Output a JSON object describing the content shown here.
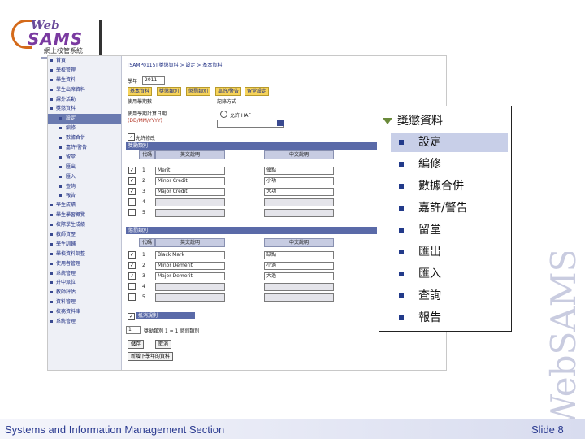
{
  "logo": {
    "web": "Web",
    "sams": "SAMS",
    "chinese": "網上校管系統"
  },
  "nav": {
    "items": [
      {
        "label": "首頁",
        "sub": false
      },
      {
        "label": "學校管理",
        "sub": false
      },
      {
        "label": "學生資料",
        "sub": false
      },
      {
        "label": "學生出席資料",
        "sub": false
      },
      {
        "label": "課外活動",
        "sub": false
      },
      {
        "label": "獎懲資料",
        "sub": false
      },
      {
        "label": "設定",
        "sub": true,
        "selected": true
      },
      {
        "label": "編修",
        "sub": true
      },
      {
        "label": "數據合併",
        "sub": true
      },
      {
        "label": "嘉許/警告",
        "sub": true
      },
      {
        "label": "留堂",
        "sub": true
      },
      {
        "label": "匯出",
        "sub": true
      },
      {
        "label": "匯入",
        "sub": true
      },
      {
        "label": "查詢",
        "sub": true
      },
      {
        "label": "報告",
        "sub": true
      },
      {
        "label": "學生成績",
        "sub": false
      },
      {
        "label": "學生學習概覽",
        "sub": false
      },
      {
        "label": "校際學生成績",
        "sub": false
      },
      {
        "label": "教師資歷",
        "sub": false
      },
      {
        "label": "學生訓輔",
        "sub": false
      },
      {
        "label": "學校資料調整",
        "sub": false
      },
      {
        "label": "使用者管理",
        "sub": false
      },
      {
        "label": "系統管理",
        "sub": false
      },
      {
        "label": "升中派位",
        "sub": false
      },
      {
        "label": "教師評估",
        "sub": false
      },
      {
        "label": "資料管理",
        "sub": false
      },
      {
        "label": "校務資料庫",
        "sub": false
      },
      {
        "label": "系統管理",
        "sub": false
      }
    ]
  },
  "main": {
    "breadcrumb": "[SAMP0115] 獎懲資料 > 設定 > 基本資料",
    "year_label": "學年",
    "year_value": "2011",
    "tabs": [
      "基本資料",
      "獎懲類別",
      "懲罰類別",
      "嘉許/警告",
      "留堂設定"
    ],
    "settings_left": "使用學期數",
    "settings_right": "記錄方式",
    "date_label": "使用學期計算日期",
    "date_format": "(DD/MM/YYYY)",
    "radio_label": "允許 HAF",
    "allow_edit": "允許修改",
    "merit_header": "獎勵類別",
    "demerit_header": "懲罰類別",
    "col_code": "代碼",
    "col_en": "英文說明",
    "col_zh": "中文說明",
    "merit_rows": [
      {
        "n": "1",
        "en": "Merit",
        "zh": "優點",
        "checked": true
      },
      {
        "n": "2",
        "en": "Minor Credit",
        "zh": "小功",
        "checked": true
      },
      {
        "n": "3",
        "en": "Major Credit",
        "zh": "大功",
        "checked": true
      },
      {
        "n": "4",
        "en": "",
        "zh": "",
        "checked": false
      },
      {
        "n": "5",
        "en": "",
        "zh": "",
        "checked": false
      }
    ],
    "demerit_rows": [
      {
        "n": "1",
        "en": "Black Mark",
        "zh": "缺點",
        "checked": true
      },
      {
        "n": "2",
        "en": "Minor Demerit",
        "zh": "小過",
        "checked": true
      },
      {
        "n": "3",
        "en": "Major Demerit",
        "zh": "大過",
        "checked": true
      },
      {
        "n": "4",
        "en": "",
        "zh": "",
        "checked": false
      },
      {
        "n": "5",
        "en": "",
        "zh": "",
        "checked": false
      }
    ],
    "convert_label": "抵消規則",
    "convert_from": "1",
    "convert_text": "獎勵類別 1 = 1 懲罰類別",
    "save_label": "儲存",
    "cancel_label": "取消",
    "bottom_label": "新增下學年的資料"
  },
  "popup": {
    "header": "獎懲資料",
    "items": [
      "設定",
      "編修",
      "數據合併",
      "嘉許/警告",
      "留堂",
      "匯出",
      "匯入",
      "查詢",
      "報告"
    ]
  },
  "side_text": "WebSAMS",
  "footer": {
    "left": "Systems and Information Management Section",
    "right": "Slide 8"
  }
}
